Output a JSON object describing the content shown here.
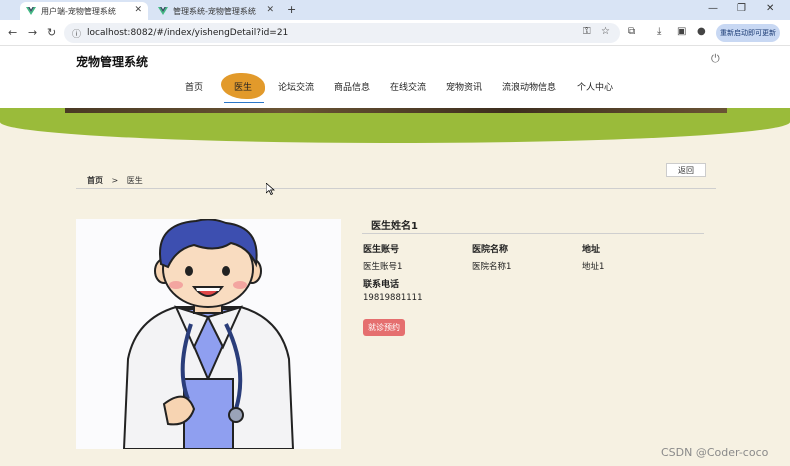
{
  "browser": {
    "tabs": [
      {
        "title": "用户端-宠物管理系统",
        "active": true
      },
      {
        "title": "管理系统-宠物管理系统",
        "active": false
      }
    ],
    "url": "localhost:8082/#/index/yishengDetail?id=21",
    "relaunch_label": "重新启动即可更新"
  },
  "site": {
    "title": "宠物管理系统",
    "nav": [
      "首页",
      "医生",
      "论坛交流",
      "商品信息",
      "在线交流",
      "宠物资讯",
      "流浪动物信息",
      "个人中心"
    ],
    "active_nav": "医生"
  },
  "breadcrumb": {
    "home": "首页",
    "separator": ">",
    "current": "医生"
  },
  "back_label": "返回",
  "doctor": {
    "name": "医生姓名1",
    "fields": [
      {
        "label": "医生账号",
        "value": "医生账号1"
      },
      {
        "label": "医院名称",
        "value": "医院名称1"
      },
      {
        "label": "地址",
        "value": "地址1"
      },
      {
        "label": "联系电话",
        "value": "19819881111"
      }
    ],
    "action_label": "就诊预约"
  },
  "watermark": "CSDN @Coder-coco",
  "colors": {
    "accent": "#e29a2b",
    "green_band": "#9abb3a",
    "action": "#e56f6f",
    "background": "#f6f1e2"
  }
}
